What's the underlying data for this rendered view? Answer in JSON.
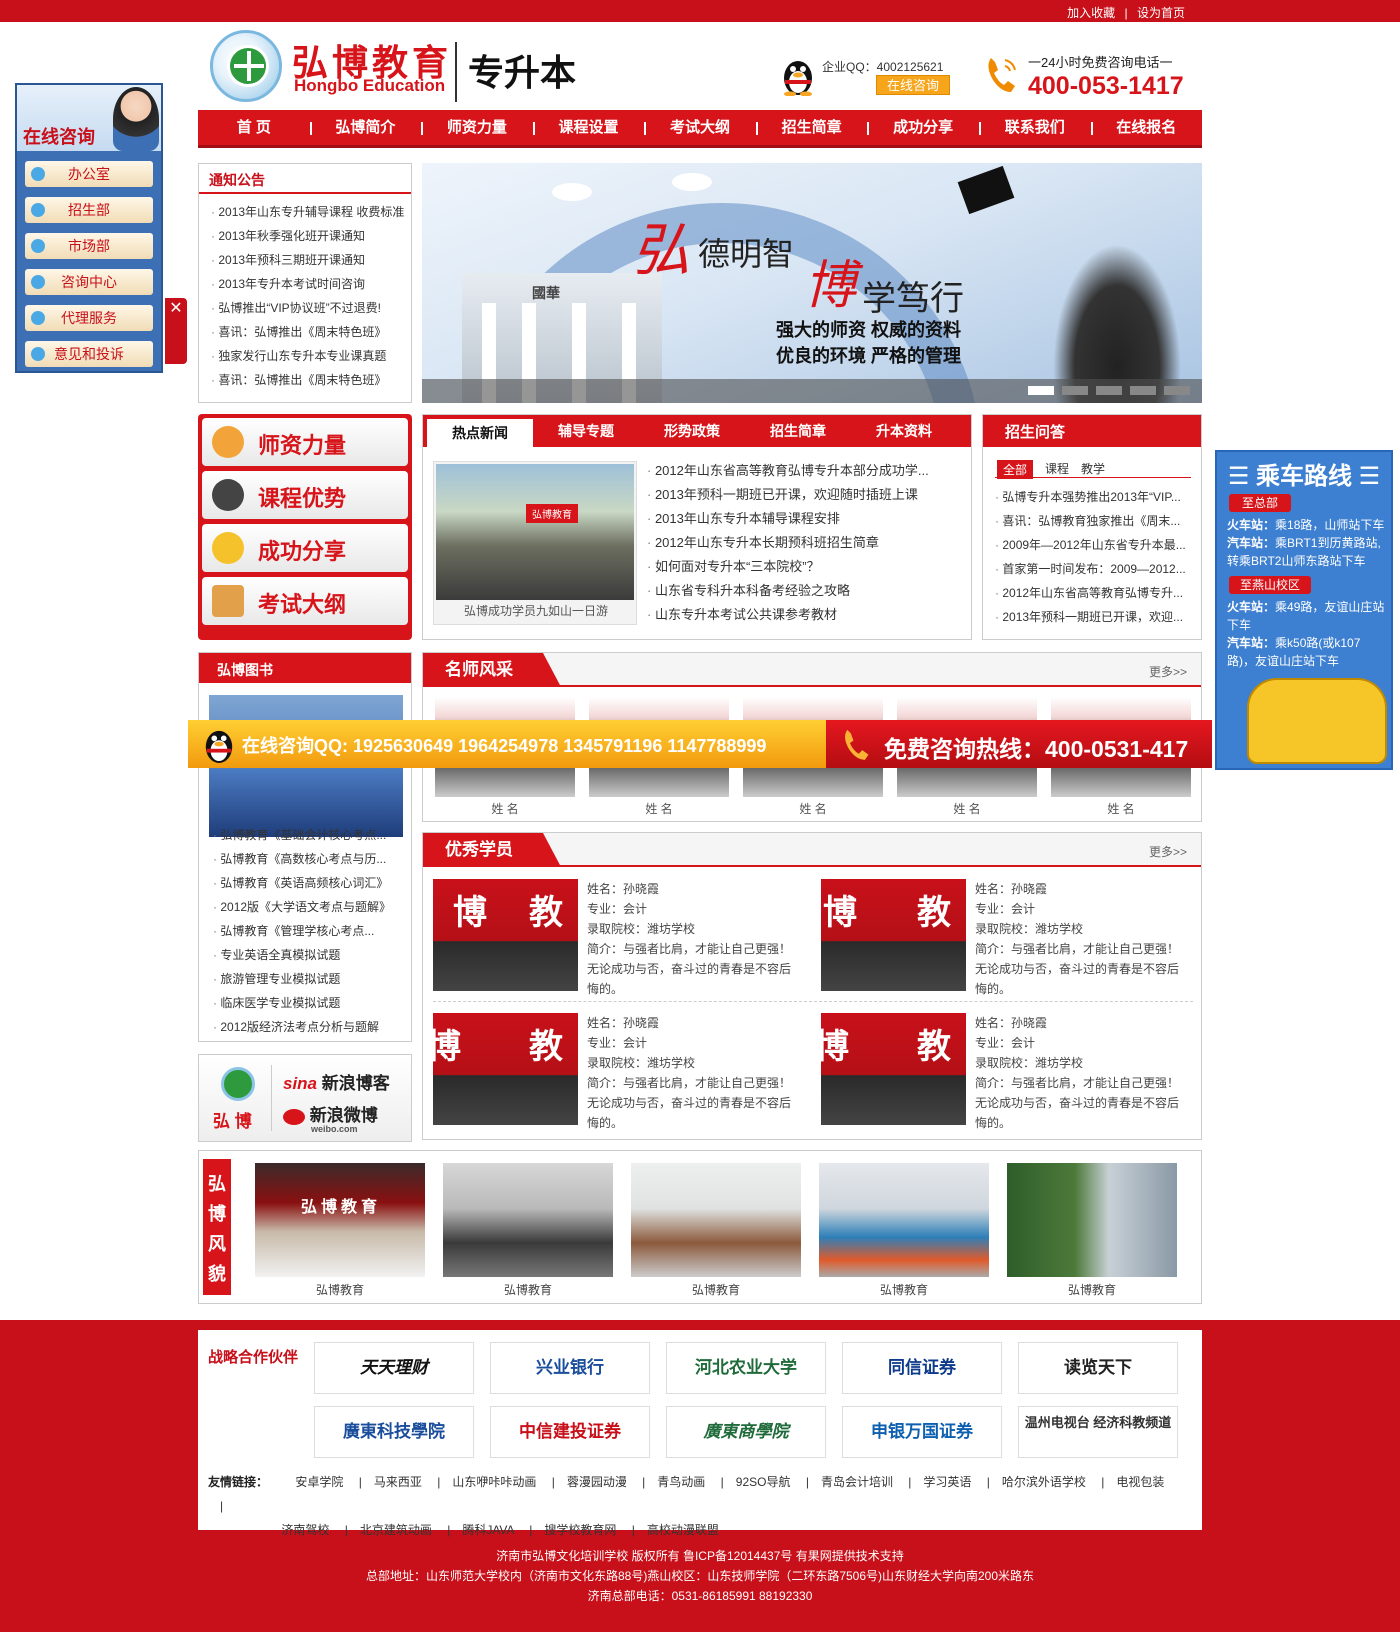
{
  "topbar": {
    "favorite": "加入收藏",
    "separator": "|",
    "homepage": "设为首页"
  },
  "header": {
    "logo_cn": "弘博教育",
    "logo_en": "Hongbo Education",
    "logo_zsb": "专升本",
    "qq_label": "企业QQ：4002125621",
    "qq_button": "在线咨询",
    "hotline_label": "一24小时免费咨询电话一",
    "hotline": "400-053-1417"
  },
  "nav": [
    "首 页",
    "弘博简介",
    "师资力量",
    "课程设置",
    "考试大纲",
    "招生简章",
    "成功分享",
    "联系我们",
    "在线报名"
  ],
  "notice": {
    "title": "通知公告",
    "items": [
      "2013年山东专升辅导课程 收费标准",
      "2013年秋季强化班开课通知",
      "2013年预科三期班开课通知",
      "2013年专升本考试时间咨询",
      "弘博推出“VIP协议班”不过退费!",
      "喜讯：弘博推出《周末特色班》",
      "独家发行山东专升本专业课真题",
      "喜讯：弘博推出《周末特色班》"
    ]
  },
  "banner": {
    "hong": "弘",
    "line1": "德明智",
    "bo": "博",
    "line2": "学笃行",
    "line3": "强大的师资  权威的资料",
    "line4": "优良的环境  严格的管理",
    "gate": "國華"
  },
  "features": [
    "师资力量",
    "课程优势",
    "成功分享",
    "考试大纲"
  ],
  "news": {
    "tabs": [
      "热点新闻",
      "辅导专题",
      "形势政策",
      "招生简章",
      "升本资料"
    ],
    "photo_caption": "弘博成功学员九如山一日游",
    "banner_text": "弘博教育",
    "items": [
      "2012年山东省高等教育弘博专升本部分成功学...",
      "2013年预科一期班已开课，欢迎随时插班上课",
      "2013年山东专升本辅导课程安排",
      "2012年山东专升本长期预科班招生简章",
      "如何面对专升本“三本院校”？",
      "山东省专科升本科备考经验之攻略",
      "山东专升本考试公共课参考教材"
    ]
  },
  "ask": {
    "title": "招生问答",
    "subtabs": [
      "全部",
      "课程",
      "教学"
    ],
    "items": [
      "弘博专升本强势推出2013年“VIP...",
      "喜讯：弘博教育独家推出《周末...",
      "2009年—2012年山东省专升本最...",
      "首家第一时间发布：2009—2012...",
      "2012年山东省高等教育弘博专升...",
      "2013年预科一期班已开课，欢迎..."
    ]
  },
  "books": {
    "title": "弘博图书",
    "items": [
      "弘博教育《基础会计核心考点...",
      "弘博教育《高数核心考点与历...",
      "弘博教育《英语高频核心词汇》",
      "2012版《大学语文考点与题解》",
      "弘博教育《管理学核心考点...",
      "专业英语全真模拟试题",
      "旅游管理专业模拟试题",
      "临床医学专业模拟试题",
      "2012版经济法考点分析与题解"
    ]
  },
  "sina": {
    "brand": "弘 博",
    "blog": "新浪博客",
    "weibo": "新浪微博",
    "weibo_en": "weibo.com",
    "sina_en": "sina"
  },
  "teachers": {
    "title": "名师风采",
    "more": "更多>>",
    "names": [
      "姓 名",
      "姓 名",
      "姓 名",
      "姓 名",
      "姓 名"
    ]
  },
  "students": {
    "title": "优秀学员",
    "more": "更多>>",
    "photo_chars": [
      "博",
      "教"
    ],
    "list": [
      {
        "name": "姓名：孙晓霞",
        "major": "专业：会计",
        "school": "录取院校：潍坊学校",
        "intro": "简介：与强者比肩，才能让自己更强！无论成功与否，奋斗过的青春是不容后悔的。"
      },
      {
        "name": "姓名：孙晓霞",
        "major": "专业：会计",
        "school": "录取院校：潍坊学校",
        "intro": "简介：与强者比肩，才能让自己更强！无论成功与否，奋斗过的青春是不容后悔的。"
      },
      {
        "name": "姓名：孙晓霞",
        "major": "专业：会计",
        "school": "录取院校：潍坊学校",
        "intro": "简介：与强者比肩，才能让自己更强！无论成功与否，奋斗过的青春是不容后悔的。"
      },
      {
        "name": "姓名：孙晓霞",
        "major": "专业：会计",
        "school": "录取院校：潍坊学校",
        "intro": "简介：与强者比肩，才能让自己更强！无论成功与否，奋斗过的青春是不容后悔的。"
      }
    ]
  },
  "style_section": {
    "label": "弘博风貌",
    "sign": "弘博教育",
    "captions": [
      "弘博教育",
      "弘博教育",
      "弘博教育",
      "弘博教育",
      "弘博教育"
    ]
  },
  "partners": {
    "title": "战略合作伙伴",
    "logos": [
      "天天理财",
      "兴业银行",
      "河北农业大学",
      "同信证券",
      "读览天下",
      "廣東科技學院",
      "中信建投证券",
      "廣東商學院",
      "申银万国证券",
      "温州电视台 经济科教频道"
    ]
  },
  "friends": {
    "label": "友情链接：",
    "links": [
      "安卓学院",
      "马来西亚",
      "山东咿咔咔动画",
      "蓉漫园动漫",
      "青鸟动画",
      "92SO导航",
      "青岛会计培训",
      "学习英语",
      "哈尔滨外语学校",
      "电视包装",
      "济南驾校",
      "北京建筑动画",
      "腾科JAVA",
      "搜学校教育网",
      "高校动漫联盟"
    ]
  },
  "footer": {
    "line1": "济南市弘博文化培训学校  版权所有  鲁ICP备12014437号   有果网提供技术支持",
    "line2": "总部地址：山东师范大学校内（济南市文化东路88号)燕山校区：山东技师学院（二环东路7506号)山东财经大学向南200米路东",
    "line3": "济南总部电话：0531-86185991   88192330"
  },
  "float_left": {
    "title": "在线咨询",
    "items": [
      "办公室",
      "招生部",
      "市场部",
      "咨询中心",
      "代理服务",
      "意见和投诉"
    ],
    "close": "✕"
  },
  "float_right": {
    "title": "乘车路线",
    "tag1": "至总部",
    "train1_label": "火车站：",
    "train1": "乘18路，山师站下车",
    "bus1_label": "汽车站：",
    "bus1": "乘BRT1到历黄路站,转乘BRT2山师东路站下车",
    "tag2": "至燕山校区",
    "train2_label": "火车站：",
    "train2": "乘49路，友谊山庄站下车",
    "bus2_label": "汽车站：",
    "bus2": "乘k50路(或k107路)，友谊山庄站下车"
  },
  "float_bar": {
    "qq_text": "在线咨询QQ: 1925630649  1964254978  1345791196  1147788999",
    "hotline_text": "免费咨询热线：400-0531-417"
  }
}
